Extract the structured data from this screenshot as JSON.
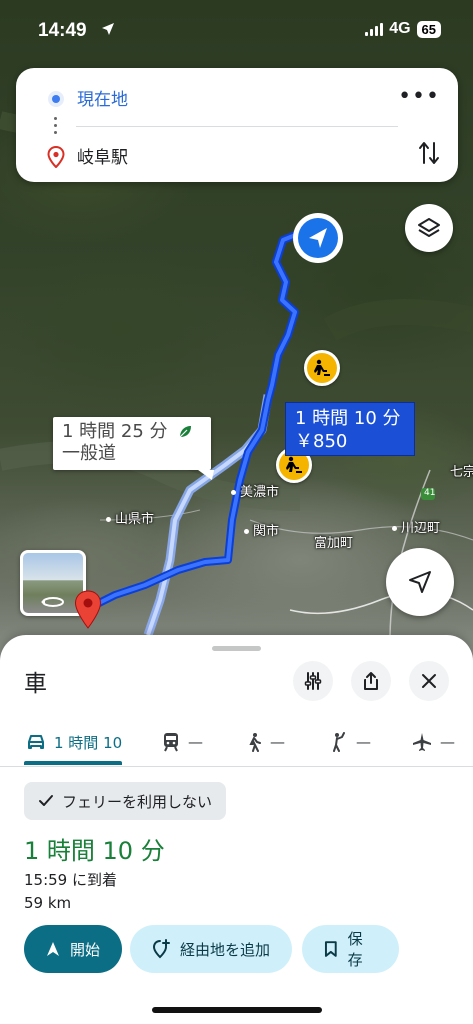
{
  "status_bar": {
    "time": "14:49",
    "network": "4G",
    "battery": "65"
  },
  "search": {
    "origin": "現在地",
    "destination": "岐阜駅",
    "more_label": "•••"
  },
  "map": {
    "labels": {
      "mino": "美濃市",
      "yamagata": "山県市",
      "seki": "関市",
      "tomika": "富加町",
      "kawabe": "川辺町",
      "route41": "41",
      "nanasou": "七宗"
    },
    "callout_primary": {
      "line1": "1 時間 10 分",
      "line2": "￥850"
    },
    "callout_alt": {
      "line1": "1 時間 25 分",
      "line2": "一般道"
    }
  },
  "sheet": {
    "mode_title": "車",
    "tabs": [
      {
        "label": "1 時間 10",
        "icon": "car-icon"
      },
      {
        "label": "—",
        "icon": "train-icon"
      },
      {
        "label": "—",
        "icon": "walk-icon"
      },
      {
        "label": "—",
        "icon": "ride-hail-icon"
      },
      {
        "label": "—",
        "icon": "flight-icon"
      }
    ],
    "ferry_chip": "フェリーを利用しない",
    "duration": "1 時間 10 分",
    "arrival": "15:59 に到着",
    "distance": "59 km",
    "buttons": {
      "start": "開始",
      "add_waypoint": "経由地を追加",
      "save": "保存"
    }
  },
  "colors": {
    "accent": "#0b6e85",
    "route_primary": "#1a4fd6",
    "duration_green": "#188038"
  }
}
